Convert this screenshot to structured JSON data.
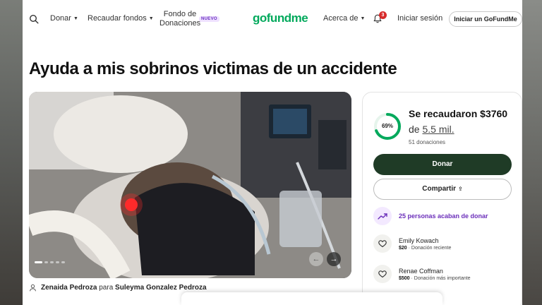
{
  "header": {
    "nav_donar": "Donar",
    "nav_recaudar": "Recaudar fondos",
    "nav_fondo_line1": "Fondo de",
    "nav_fondo_line2": "Donaciones",
    "nuevo_badge": "NUEVO",
    "logo": "gofundme",
    "nav_acerca": "Acerca de",
    "notification_count": "3",
    "login": "Iniciar sesión",
    "start_button": "Iniciar un GoFundMe",
    "icons": [
      "search-icon",
      "chevron-down-icon",
      "bell-icon"
    ]
  },
  "campaign": {
    "title": "Ayuda a mis sobrinos victimas de un accidente",
    "organizer_name": "Zenaida Pedroza",
    "organizer_for": "para",
    "beneficiary_name": "Suleyma Gonzalez Pedroza"
  },
  "photo": {
    "slide_count": 5,
    "active_slide": 1
  },
  "card": {
    "progress_percent": "69%",
    "progress_fraction": 0.69,
    "raised_title": "Se recaudaron $3760",
    "goal_prefix": "de",
    "goal_amount": "5.5 mil.",
    "donation_count": "51 donaciones",
    "donate_label": "Donar",
    "share_label": "Compartir",
    "trend_text": "25 personas acaban de donar",
    "donors": [
      {
        "name": "Emily Kowach",
        "amount": "$20",
        "detail": "· Donación reciente"
      },
      {
        "name": "Renae Coffman",
        "amount": "$500",
        "detail": "· Donación más importante"
      }
    ]
  },
  "colors": {
    "brand_green": "#02a95c",
    "donate_button": "#1f3b26",
    "trend_purple": "#6b2fba",
    "badge_red": "#d72b2b"
  }
}
